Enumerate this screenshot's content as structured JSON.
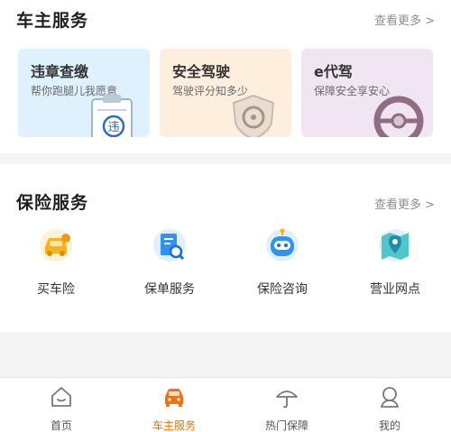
{
  "owner_services": {
    "title": "车主服务",
    "more": "查看更多 >",
    "cards": [
      {
        "title": "违章查缴",
        "subtitle": "帮你跑腿儿我愿意",
        "icon": "violation-clipboard-icon",
        "badge": "违",
        "bg": "#dff1fc"
      },
      {
        "title": "安全驾驶",
        "subtitle": "驾驶评分知多少",
        "icon": "shield-steering-icon",
        "bg": "#fdeedd"
      },
      {
        "title": "e代驾",
        "subtitle": "保障安全享安心",
        "icon": "steering-wheel-icon",
        "bg": "#f1e5f4"
      }
    ]
  },
  "insurance_services": {
    "title": "保险服务",
    "more": "查看更多 >",
    "items": [
      {
        "label": "买车险",
        "icon": "car-insurance-icon"
      },
      {
        "label": "保单服务",
        "icon": "policy-search-icon"
      },
      {
        "label": "保险咨询",
        "icon": "robot-consult-icon"
      },
      {
        "label": "营业网点",
        "icon": "map-location-icon"
      }
    ]
  },
  "tabbar": {
    "tabs": [
      {
        "label": "首页",
        "icon": "home-icon",
        "active": false
      },
      {
        "label": "车主服务",
        "icon": "car-icon",
        "active": true
      },
      {
        "label": "热门保障",
        "icon": "umbrella-icon",
        "active": false
      },
      {
        "label": "我的",
        "icon": "profile-icon",
        "active": false
      }
    ]
  },
  "colors": {
    "accent": "#f0730f",
    "insurance_blue": "#2f93f0",
    "insurance_orange": "#f7b21a"
  }
}
